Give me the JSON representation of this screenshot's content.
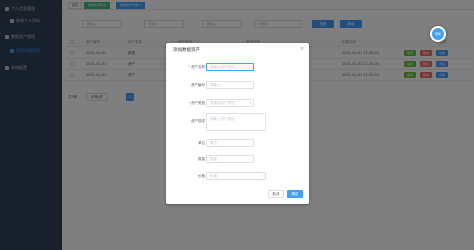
{
  "sidebar": {
    "items": [
      {
        "label": "个人信息管理",
        "icon": "user-icon"
      },
      {
        "label": "修改个人资料",
        "icon": "edit-icon"
      },
      {
        "label": "数据资产管理",
        "icon": "folder-icon"
      },
      {
        "label": "资源申请管理",
        "icon": "list-icon"
      },
      {
        "label": "系统配置",
        "icon": "gear-icon"
      }
    ]
  },
  "tabs": [
    {
      "label": "首页"
    },
    {
      "label": "数据资源申请"
    },
    {
      "label": "数据资产管理 ×"
    }
  ],
  "filters": {
    "search1_placeholder": "请输入",
    "search2_placeholder": "请输入",
    "search3_placeholder": "请输入",
    "select_placeholder": "请选择",
    "search_button": "搜索",
    "add_button": "新增"
  },
  "table": {
    "headers": [
      "资产编号",
      "资产名称",
      "资产类型",
      "申请状态",
      "创建时间",
      "操作"
    ],
    "rows": [
      {
        "id": "2021-01-01",
        "name": "数据",
        "type": "",
        "status": "",
        "time": "2021-01-01 12:30:20"
      },
      {
        "id": "2021-01-01",
        "name": "资产",
        "type": "",
        "status": "",
        "time": "2021-01-01 12:30:20"
      },
      {
        "id": "2021-01-01",
        "name": "资产",
        "type": "",
        "status": "",
        "time": "2021-01-01 12:30:20"
      }
    ],
    "row_actions": [
      "编辑",
      "删除",
      "详情"
    ]
  },
  "pagination": {
    "total": "共3条",
    "page_size": "10条/页",
    "current_page": "1"
  },
  "dialog": {
    "title": "添加数据资产",
    "close": "×",
    "fields": [
      {
        "label": "资产名称",
        "placeholder": "请输入资产名称"
      },
      {
        "label": "资产编号",
        "placeholder": "请输入"
      },
      {
        "label": "资产类型",
        "placeholder": "请选择资产类型"
      },
      {
        "label": "资产描述",
        "placeholder": "请输入资产描述"
      },
      {
        "label": "单位",
        "placeholder": "单位"
      },
      {
        "label": "数量",
        "placeholder": "数量"
      },
      {
        "label": "价格",
        "placeholder": "价格"
      }
    ],
    "cancel": "取消",
    "confirm": "确定"
  },
  "fab": {
    "label": "帮助"
  }
}
